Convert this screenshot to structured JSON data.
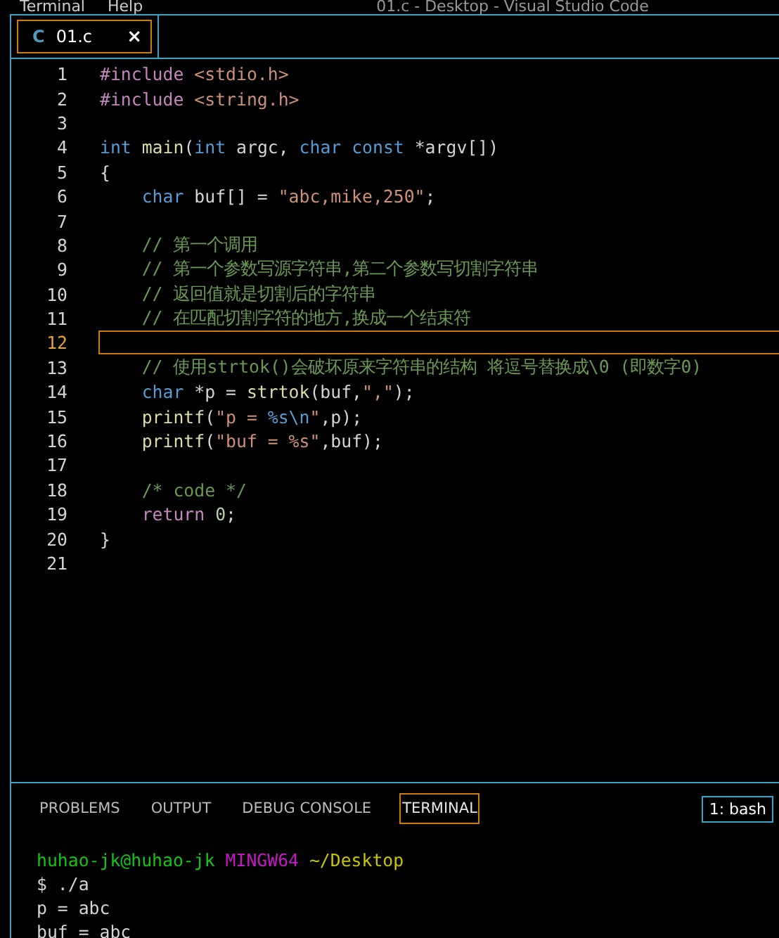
{
  "window": {
    "menu": [
      "Terminal",
      "Help"
    ],
    "title": "01.c - Desktop - Visual Studio Code"
  },
  "tabs": [
    {
      "icon_text": "C",
      "label": "01.c",
      "close": "×",
      "selected": true
    }
  ],
  "editor": {
    "lines": [
      {
        "number": "1",
        "current": false,
        "tokens": [
          {
            "text": "#include",
            "kind": "ctrl"
          },
          {
            "text": " <stdio.h>",
            "kind": "str"
          }
        ]
      },
      {
        "number": "2",
        "current": false,
        "tokens": [
          {
            "text": "#include",
            "kind": "ctrl"
          },
          {
            "text": " <string.h>",
            "kind": "str"
          }
        ]
      },
      {
        "number": "3",
        "current": false
      },
      {
        "number": "4",
        "current": false,
        "tokens": [
          {
            "text": "int",
            "kind": "kw"
          },
          {
            "text": " main",
            "kind": "fn"
          },
          {
            "text": "(",
            "kind": "plain"
          },
          {
            "text": "int",
            "kind": "kw"
          },
          {
            "text": " argc, ",
            "kind": "plain"
          },
          {
            "text": "char const",
            "kind": "kw"
          },
          {
            "text": " *argv[])",
            "kind": "plain"
          }
        ]
      },
      {
        "number": "5",
        "current": false,
        "tokens": [
          {
            "text": "{",
            "kind": "plain"
          }
        ]
      },
      {
        "number": "6",
        "current": false,
        "tokens": [
          {
            "text": "    char",
            "kind": "kw"
          },
          {
            "text": " buf[] = ",
            "kind": "plain"
          },
          {
            "text": "\"abc,mike,250\"",
            "kind": "str"
          },
          {
            "text": ";",
            "kind": "plain"
          }
        ]
      },
      {
        "number": "7",
        "current": false
      },
      {
        "number": "8",
        "current": false,
        "tokens": [
          {
            "text": "    // 第一个调用",
            "kind": "cm"
          }
        ]
      },
      {
        "number": "9",
        "current": false,
        "tokens": [
          {
            "text": "    // 第一个参数写源字符串,第二个参数写切割字符串",
            "kind": "cm"
          }
        ]
      },
      {
        "number": "10",
        "current": false,
        "tokens": [
          {
            "text": "    // 返回值就是切割后的字符串",
            "kind": "cm"
          }
        ]
      },
      {
        "number": "11",
        "current": false,
        "tokens": [
          {
            "text": "    // 在匹配切割字符的地方,换成一个结束符",
            "kind": "cm"
          }
        ]
      },
      {
        "number": "12",
        "current": true
      },
      {
        "number": "13",
        "current": false,
        "tokens": [
          {
            "text": "    // 使用strtok()会破坏原来字符串的结构 将逗号替换成\\0 (即数字0)",
            "kind": "cm"
          }
        ]
      },
      {
        "number": "14",
        "current": false,
        "tokens": [
          {
            "text": "    char",
            "kind": "kw"
          },
          {
            "text": " *p = ",
            "kind": "plain"
          },
          {
            "text": "strtok",
            "kind": "fn"
          },
          {
            "text": "(buf,",
            "kind": "plain"
          },
          {
            "text": "\",\"",
            "kind": "str"
          },
          {
            "text": ");",
            "kind": "plain"
          }
        ]
      },
      {
        "number": "15",
        "current": false,
        "tokens": [
          {
            "text": "    printf",
            "kind": "fn"
          },
          {
            "text": "(",
            "kind": "plain"
          },
          {
            "text": "\"p = ",
            "kind": "str"
          },
          {
            "text": "%s\\n",
            "kind": "kw"
          },
          {
            "text": "\"",
            "kind": "str"
          },
          {
            "text": ",p);",
            "kind": "plain"
          }
        ]
      },
      {
        "number": "16",
        "current": false,
        "tokens": [
          {
            "text": "    printf",
            "kind": "fn"
          },
          {
            "text": "(",
            "kind": "plain"
          },
          {
            "text": "\"buf = %s\"",
            "kind": "str"
          },
          {
            "text": ",buf);",
            "kind": "plain"
          }
        ]
      },
      {
        "number": "17",
        "current": false
      },
      {
        "number": "18",
        "current": false,
        "tokens": [
          {
            "text": "    /* code */",
            "kind": "cm"
          }
        ]
      },
      {
        "number": "19",
        "current": false,
        "tokens": [
          {
            "text": "    return",
            "kind": "ctrl"
          },
          {
            "text": " 0",
            "kind": "num"
          },
          {
            "text": ";",
            "kind": "plain"
          }
        ]
      },
      {
        "number": "20",
        "current": false,
        "tokens": [
          {
            "text": "}",
            "kind": "plain"
          }
        ]
      },
      {
        "number": "21",
        "current": false
      }
    ]
  },
  "panel": {
    "tabs": [
      {
        "label": "PROBLEMS",
        "selected": false
      },
      {
        "label": "OUTPUT",
        "selected": false
      },
      {
        "label": "DEBUG CONSOLE",
        "selected": false
      },
      {
        "label": "TERMINAL",
        "selected": true
      }
    ],
    "terminal_select": "1: bash",
    "terminal_lines": [
      [
        {
          "text": "huhao-jk@huhao-jk ",
          "kind": "user"
        },
        {
          "text": "MINGW64 ",
          "kind": "env"
        },
        {
          "text": "~/Desktop",
          "kind": "path"
        }
      ],
      [
        {
          "text": "$ ./a",
          "kind": "plain"
        }
      ],
      [
        {
          "text": "p = abc",
          "kind": "plain"
        }
      ],
      [
        {
          "text": "buf = abc",
          "kind": "plain"
        }
      ]
    ]
  }
}
